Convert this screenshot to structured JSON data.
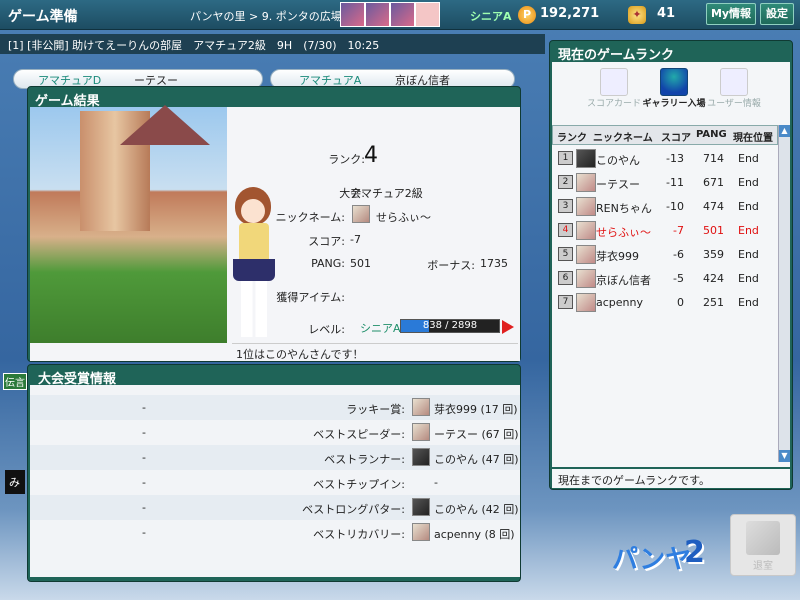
{
  "header": {
    "title": "ゲーム準備",
    "breadcrumb": "パンヤの里 > 9. ポンタの広場",
    "rank_badge": "シニアA",
    "pang_icon": "P",
    "pang": "192,271",
    "cookie_amount": "41",
    "my_info_label": "My情報",
    "settings_label": "設定"
  },
  "room": {
    "info": "[1] [非公開] 助けてえーりんの部屋　アマチュア2級　9H　(7/30)　10:25"
  },
  "lobby_rows": [
    {
      "rank": "アマチュアD",
      "name": "ーテスー"
    },
    {
      "rank": "アマチュアA",
      "name": "京ぼん信者"
    }
  ],
  "result": {
    "title": "ゲーム結果",
    "rank_label": "ランク:",
    "rank_value": "4",
    "tournament_label": "大会:",
    "tournament_value": "アマチュア2級",
    "nickname_label": "ニックネーム:",
    "nickname_value": "せらふぃ〜",
    "score_label": "スコア:",
    "score_value": "-7",
    "pang_label": "PANG:",
    "pang_value": "501",
    "bonus_label": "ボーナス:",
    "bonus_value": "1735",
    "items_label": "獲得アイテム:",
    "level_label": "レベル:",
    "level_grade": "シニアA",
    "level_text": "838 / 2898",
    "level_progress": 0.289,
    "message": "1位はこのやんさんです！"
  },
  "awards": {
    "title": "大会受賞情報",
    "rows": [
      {
        "name": "ラッキー賞:",
        "winner": "芽衣999 (17 回)"
      },
      {
        "name": "ベストスピーダー:",
        "winner": "ーテスー (67 回)"
      },
      {
        "name": "ベストランナー:",
        "winner": "このやん (47 回)"
      },
      {
        "name": "ベストチップイン:",
        "winner": "-"
      },
      {
        "name": "ベストロングパター:",
        "winner": "このやん (42 回)"
      },
      {
        "name": "ベストリカバリー:",
        "winner": "acpenny (8 回)"
      }
    ],
    "dash": "-"
  },
  "rank_panel": {
    "title": "現在のゲームランク",
    "tabs": [
      "スコアカード",
      "ギャラリー入場",
      "ユーザー情報"
    ],
    "columns": {
      "rank": "ランク",
      "nickname": "ニックネーム",
      "score": "スコア",
      "pang": "PANG",
      "position": "現在位置"
    },
    "players": [
      {
        "rank": "1",
        "name": "このやん",
        "score": "-13",
        "pang": "714",
        "position": "End"
      },
      {
        "rank": "2",
        "name": "ーテスー",
        "score": "-11",
        "pang": "671",
        "position": "End"
      },
      {
        "rank": "3",
        "name": "RENちゃん",
        "score": "-10",
        "pang": "474",
        "position": "End"
      },
      {
        "rank": "4",
        "name": "せらふぃ〜",
        "score": "-7",
        "pang": "501",
        "position": "End"
      },
      {
        "rank": "5",
        "name": "芽衣999",
        "score": "-6",
        "pang": "359",
        "position": "End"
      },
      {
        "rank": "6",
        "name": "京ぼん信者",
        "score": "-5",
        "pang": "424",
        "position": "End"
      },
      {
        "rank": "7",
        "name": "acpenny",
        "score": "0",
        "pang": "251",
        "position": "End"
      }
    ],
    "footer": "現在までのゲームランクです。"
  },
  "bottom": {
    "exit_label": "退室",
    "logo_text": "パンヤ",
    "logo_number": "2",
    "chat_prefix": "み",
    "chat_tag": "伝言"
  }
}
